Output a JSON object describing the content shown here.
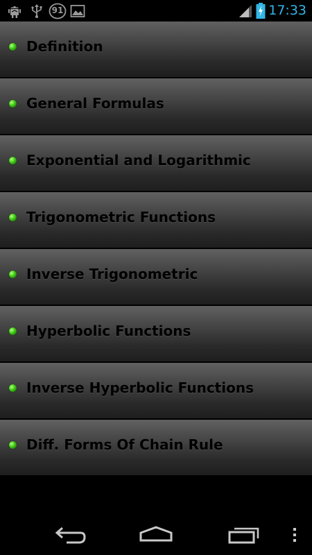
{
  "status_bar": {
    "time": "17:33",
    "notification_badge": "91",
    "icons": [
      "android-debug-icon",
      "usb-icon",
      "notification-count-icon",
      "image-icon",
      "signal-icon",
      "battery-charging-icon"
    ],
    "time_color": "#33b5e5"
  },
  "menu": {
    "items": [
      {
        "label": "Definition"
      },
      {
        "label": "General Formulas"
      },
      {
        "label": "Exponential and Logarithmic"
      },
      {
        "label": "Trigonometric Functions"
      },
      {
        "label": "Inverse Trigonometric"
      },
      {
        "label": "Hyperbolic Functions"
      },
      {
        "label": "Inverse Hyperbolic Functions"
      },
      {
        "label": "Diff. Forms Of Chain Rule"
      }
    ],
    "bullet_color": "#3fc61a"
  },
  "nav_bar": {
    "buttons": [
      "back-icon",
      "home-icon",
      "recent-apps-icon",
      "overflow-menu-icon"
    ]
  }
}
